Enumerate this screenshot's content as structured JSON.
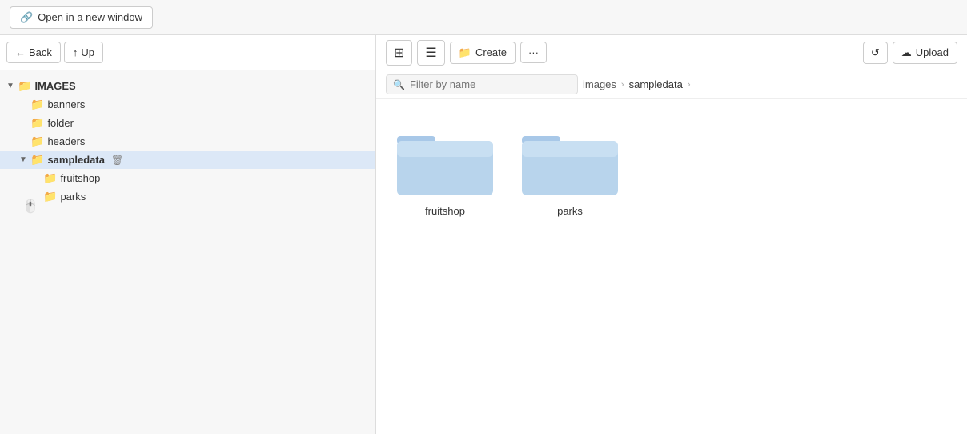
{
  "topbar": {
    "open_new_window_label": "Open in a new window"
  },
  "sidebar": {
    "back_label": "Back",
    "up_label": "Up",
    "tree": [
      {
        "id": "images",
        "label": "IMAGES",
        "indent": 0,
        "type": "folder-open",
        "expanded": true,
        "bold": true,
        "chevron": "▼"
      },
      {
        "id": "banners",
        "label": "banners",
        "indent": 1,
        "type": "folder-closed",
        "expanded": false,
        "chevron": ""
      },
      {
        "id": "folder",
        "label": "folder",
        "indent": 1,
        "type": "folder-closed",
        "expanded": false,
        "chevron": ""
      },
      {
        "id": "headers",
        "label": "headers",
        "indent": 1,
        "type": "folder-closed",
        "expanded": false,
        "chevron": ""
      },
      {
        "id": "sampledata",
        "label": "sampledata",
        "indent": 1,
        "type": "folder-open",
        "expanded": true,
        "bold": true,
        "chevron": "▼",
        "delete": true,
        "selected": true
      },
      {
        "id": "fruitshop",
        "label": "fruitshop",
        "indent": 2,
        "type": "folder-closed",
        "expanded": false,
        "chevron": ""
      },
      {
        "id": "parks",
        "label": "parks",
        "indent": 2,
        "type": "folder-closed",
        "expanded": false,
        "chevron": ""
      }
    ]
  },
  "toolbar": {
    "grid_view_label": "⊞",
    "list_view_label": "☰",
    "create_label": "Create",
    "more_label": "···",
    "refresh_label": "↺",
    "upload_label": "Upload"
  },
  "breadcrumb": {
    "search_placeholder": "Filter by name",
    "items": [
      {
        "id": "images",
        "label": "images"
      },
      {
        "id": "sampledata",
        "label": "sampledata"
      }
    ]
  },
  "content": {
    "folders": [
      {
        "id": "fruitshop",
        "name": "fruitshop"
      },
      {
        "id": "parks",
        "name": "parks"
      }
    ]
  }
}
